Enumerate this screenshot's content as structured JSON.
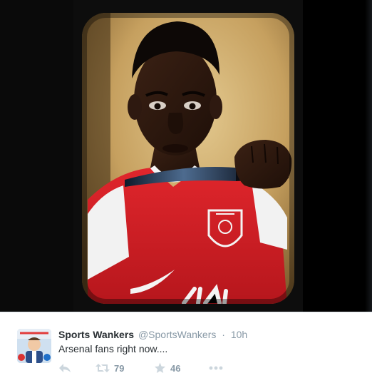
{
  "tweet": {
    "display_name": "Sports Wankers",
    "handle": "@SportsWankers",
    "separator": "·",
    "time": "10h",
    "text": "Arsenal fans right now....",
    "retweets": "79",
    "favorites": "46"
  },
  "icons": {
    "reply": "reply-icon",
    "retweet": "retweet-icon",
    "favorite": "star-icon",
    "more": "more-icon"
  },
  "colors": {
    "name": "#292f33",
    "muted": "#8899a6",
    "action_icon": "#ccd6dd",
    "jersey_red": "#d21f26"
  }
}
